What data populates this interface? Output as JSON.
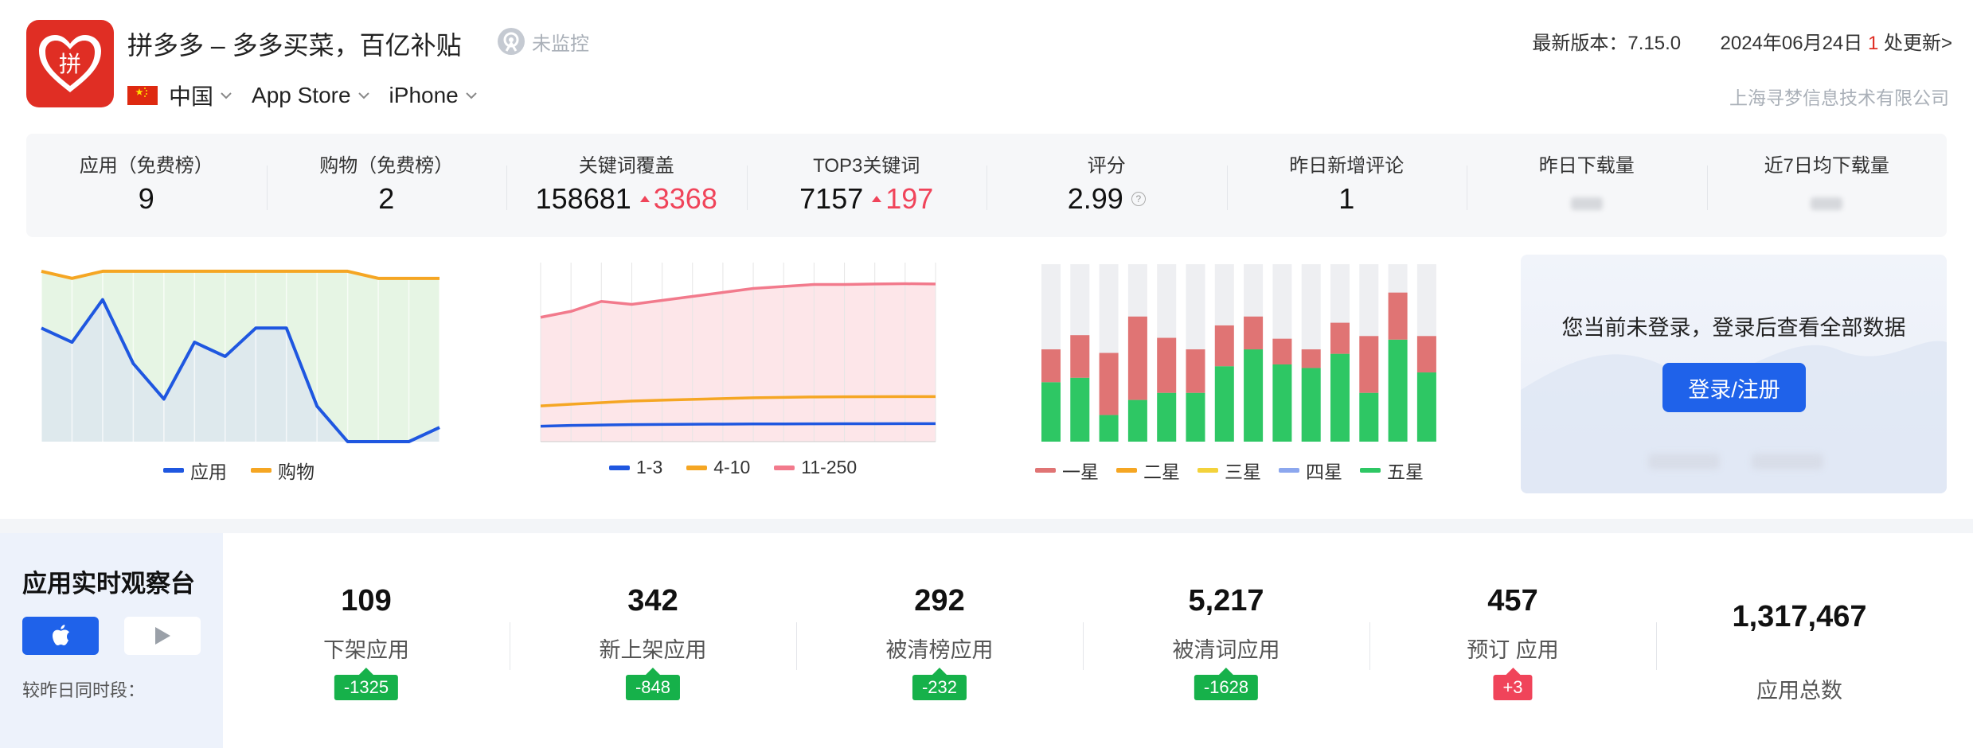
{
  "app": {
    "title": "拼多多 – 多多买菜，百亿补贴",
    "monitor_status": "未监控",
    "country": "中国",
    "store": "App Store",
    "device": "iPhone",
    "version_label": "最新版本：",
    "version": "7.15.0",
    "update_date": "2024年06月24日",
    "update_count": "1",
    "update_suffix": "处更新>",
    "company": "上海寻梦信息技术有限公司",
    "logo_text": "拼"
  },
  "stats": [
    {
      "label": "应用（免费榜）",
      "value": "9"
    },
    {
      "label": "购物（免费榜）",
      "value": "2"
    },
    {
      "label": "关键词覆盖",
      "value": "158681",
      "delta": "3368"
    },
    {
      "label": "TOP3关键词",
      "value": "7157",
      "delta": "197"
    },
    {
      "label": "评分",
      "value": "2.99"
    },
    {
      "label": "昨日新增评论",
      "value": "1"
    },
    {
      "label": "昨日下载量",
      "value": ""
    },
    {
      "label": "近7日均下载量",
      "value": ""
    }
  ],
  "chart_data": [
    {
      "type": "line",
      "series": [
        {
          "name": "应用",
          "color": "#1f57e0",
          "values": [
            9,
            11,
            5,
            14,
            19,
            11,
            13,
            9,
            9,
            20,
            25,
            25,
            25,
            23
          ]
        },
        {
          "name": "购物",
          "color": "#f5a623",
          "values": [
            1,
            2,
            1,
            1,
            1,
            1,
            1,
            1,
            1,
            1,
            1,
            2,
            2,
            2
          ]
        }
      ],
      "ylim": [
        0,
        25
      ],
      "inverted": true,
      "grid": true
    },
    {
      "type": "area",
      "series": [
        {
          "name": "1-3",
          "color": "#1f57e0",
          "values": [
            150,
            160,
            165,
            170,
            172,
            175,
            176,
            178,
            179,
            180,
            181,
            181,
            182,
            182
          ]
        },
        {
          "name": "4-10",
          "color": "#f5a623",
          "values": [
            400,
            420,
            440,
            460,
            470,
            480,
            490,
            500,
            505,
            510,
            512,
            513,
            514,
            514
          ]
        },
        {
          "name": "11-250",
          "color": "#f27a8c",
          "values": [
            125000,
            131000,
            141000,
            138000,
            142000,
            146000,
            150000,
            154000,
            156000,
            158000,
            158000,
            158500,
            158800,
            158500
          ]
        }
      ],
      "ylim": [
        0,
        180000
      ],
      "grid": true
    },
    {
      "type": "bar",
      "stacked": true,
      "series": [
        {
          "name": "一星",
          "color": "#e07474",
          "values": [
            37,
            48,
            70,
            94,
            62,
            49,
            46,
            37,
            29,
            21,
            35,
            64,
            53,
            41
          ]
        },
        {
          "name": "二星",
          "color": "#f5a623",
          "values": [
            0,
            0,
            0,
            0,
            0,
            0,
            0,
            0,
            0,
            0,
            0,
            0,
            0,
            0
          ]
        },
        {
          "name": "三星",
          "color": "#f3d23b",
          "values": [
            0,
            0,
            0,
            0,
            0,
            0,
            0,
            0,
            0,
            0,
            0,
            0,
            0,
            0
          ]
        },
        {
          "name": "四星",
          "color": "#8ca7ee",
          "values": [
            0,
            0,
            0,
            0,
            0,
            0,
            0,
            0,
            0,
            0,
            0,
            0,
            0,
            0
          ]
        },
        {
          "name": "五星",
          "color": "#2ec764",
          "values": [
            67,
            72,
            30,
            47,
            55,
            55,
            85,
            104,
            87,
            83,
            99,
            55,
            115,
            78
          ]
        }
      ],
      "ylim": [
        0,
        200
      ]
    }
  ],
  "login": {
    "message": "您当前未登录，登录后查看全部数据",
    "button": "登录/注册"
  },
  "observatory": {
    "title": "应用实时观察台",
    "compare_label": "较昨日同时段：",
    "metrics": [
      {
        "value": "109",
        "label": "下架应用",
        "delta": "-1325",
        "trend": "down"
      },
      {
        "value": "342",
        "label": "新上架应用",
        "delta": "-848",
        "trend": "down"
      },
      {
        "value": "292",
        "label": "被清榜应用",
        "delta": "-232",
        "trend": "down"
      },
      {
        "value": "5,217",
        "label": "被清词应用",
        "delta": "-1628",
        "trend": "down"
      },
      {
        "value": "457",
        "label": "预订 应用",
        "delta": "+3",
        "trend": "up"
      },
      {
        "value": "1,317,467",
        "label": "应用总数"
      }
    ]
  }
}
